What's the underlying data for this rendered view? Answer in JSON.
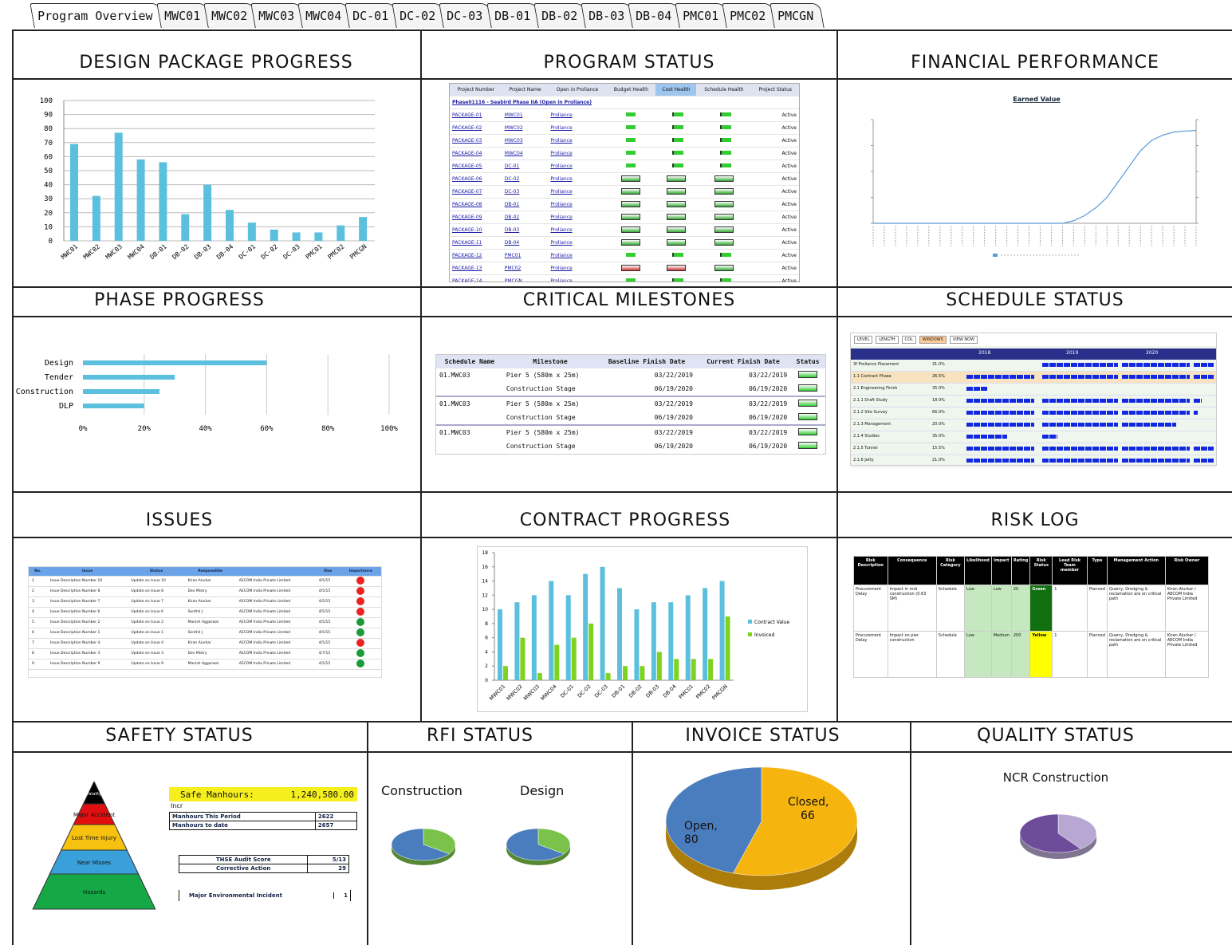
{
  "tabs": [
    "Program Overview",
    "MWC01",
    "MWC02",
    "MWC03",
    "MWC04",
    "DC-01",
    "DC-02",
    "DC-03",
    "DB-01",
    "DB-02",
    "DB-03",
    "DB-04",
    "PMC01",
    "PMC02",
    "PMCGN"
  ],
  "panels": {
    "design_package_progress": "DESIGN PACKAGE PROGRESS",
    "program_status": "PROGRAM STATUS",
    "financial_performance": "FINANCIAL PERFORMANCE",
    "phase_progress": "PHASE PROGRESS",
    "critical_milestones": "CRITICAL MILESTONES",
    "schedule_status": "SCHEDULE STATUS",
    "issues": "ISSUES",
    "contract_progress": "CONTRACT PROGRESS",
    "risk_log": "RISK LOG",
    "safety_status": "SAFETY STATUS",
    "rfi_status": "RFI STATUS",
    "invoice_status": "INVOICE STATUS",
    "quality_status": "QUALITY STATUS"
  },
  "chart_data": [
    {
      "type": "bar",
      "name": "design-package-progress",
      "categories": [
        "MWC01",
        "MWC02",
        "MWC03",
        "MWC04",
        "DB-01",
        "DB-02",
        "DB-03",
        "DB-04",
        "DC-01",
        "DC-02",
        "DC-03",
        "PMC01",
        "PMC02",
        "PMCGN"
      ],
      "values": [
        69,
        32,
        77,
        58,
        56,
        19,
        40,
        22,
        13,
        8,
        6,
        6,
        11,
        17
      ],
      "ylim": [
        0,
        100
      ],
      "yticks": [
        0,
        10,
        20,
        30,
        40,
        50,
        60,
        70,
        80,
        90,
        100
      ]
    },
    {
      "type": "bar",
      "orientation": "horizontal",
      "name": "phase-progress",
      "categories": [
        "Design",
        "Tender",
        "Construction",
        "DLP"
      ],
      "values": [
        60,
        30,
        25,
        20
      ],
      "xticks": [
        "0%",
        "20%",
        "40%",
        "60%",
        "80%",
        "100%"
      ]
    },
    {
      "type": "bar",
      "name": "contract-progress",
      "categories": [
        "MWC01",
        "MWC02",
        "MWC03",
        "MWC04",
        "DC-01",
        "DC-02",
        "DC-03",
        "DB-01",
        "DB-02",
        "DB-03",
        "DB-04",
        "PMC01",
        "PMC02",
        "PMCGN"
      ],
      "series": [
        {
          "name": "Contract Value",
          "values": [
            10,
            11,
            12,
            14,
            12,
            15,
            16,
            13,
            10,
            11,
            11,
            12,
            13,
            14
          ]
        },
        {
          "name": "Invoiced",
          "values": [
            2,
            6,
            1,
            5,
            6,
            8,
            1,
            2,
            2,
            4,
            3,
            3,
            3,
            9
          ]
        }
      ],
      "ylim": [
        0,
        18
      ],
      "yticks": [
        0,
        2,
        4,
        6,
        8,
        10,
        12,
        14,
        16,
        18
      ],
      "legend": "right"
    },
    {
      "type": "line",
      "name": "financial-performance",
      "title": "Earned Value",
      "values": [
        0,
        0,
        0,
        0,
        0,
        0,
        0,
        0,
        0,
        0,
        0,
        0,
        0,
        0,
        0,
        0,
        0,
        0,
        0.5,
        1.5,
        3,
        5,
        8,
        11,
        14,
        16,
        17,
        17.6,
        17.8,
        17.9
      ],
      "ylim": [
        0,
        20
      ],
      "legend": "bottom"
    },
    {
      "type": "pie",
      "name": "invoice-status",
      "labels": [
        "Open",
        "Closed"
      ],
      "values": [
        80,
        66
      ],
      "colors": [
        "#f6b40f",
        "#4a7dbd"
      ]
    },
    {
      "type": "pie",
      "name": "rfi-construction",
      "title": "Construction",
      "labels": [
        "Open",
        "Closed"
      ],
      "values": [
        35,
        65
      ],
      "colors": [
        "#7bc24a",
        "#4a7dbd"
      ]
    },
    {
      "type": "pie",
      "name": "rfi-design",
      "title": "Design",
      "labels": [
        "Open",
        "Closed"
      ],
      "values": [
        35,
        65
      ],
      "colors": [
        "#7bc24a",
        "#4a7dbd"
      ]
    },
    {
      "type": "pie",
      "name": "quality-ncr",
      "title": "NCR Construction",
      "labels": [
        "Open",
        "Closed"
      ],
      "values": [
        40,
        60
      ],
      "colors": [
        "#b7a7d2",
        "#6d4c9a"
      ]
    }
  ],
  "program_status": {
    "headers": [
      "Project Number",
      "Project Name",
      "Open in Proliance",
      "Budget Health",
      "Cost Health",
      "Schedule Health",
      "Project Status"
    ],
    "group": "Phase01116 - Seabird Phase IIA (Open in Proliance)",
    "rows": [
      [
        "PACKAGE-01",
        "MWC01",
        "Proliance",
        "Active"
      ],
      [
        "PACKAGE-02",
        "MWC02",
        "Proliance",
        "Active"
      ],
      [
        "PACKAGE-03",
        "MWC03",
        "Proliance",
        "Active"
      ],
      [
        "PACKAGE-04",
        "MWC04",
        "Proliance",
        "Active"
      ],
      [
        "PACKAGE-05",
        "DC-01",
        "Proliance",
        "Active"
      ],
      [
        "PACKAGE-06",
        "DC-02",
        "Proliance",
        "Active"
      ],
      [
        "PACKAGE-07",
        "DC-03",
        "Proliance",
        "Active"
      ],
      [
        "PACKAGE-08",
        "DB-01",
        "Proliance",
        "Active"
      ],
      [
        "PACKAGE-09",
        "DB-02",
        "Proliance",
        "Active"
      ],
      [
        "PACKAGE-10",
        "DB-03",
        "Proliance",
        "Active"
      ],
      [
        "PACKAGE-11",
        "DB-04",
        "Proliance",
        "Active"
      ],
      [
        "PACKAGE-12",
        "PMC01",
        "Proliance",
        "Active"
      ],
      [
        "PACKAGE-13",
        "PMC02",
        "Proliance",
        "Active"
      ],
      [
        "PACKAGE-14",
        "PMCGN",
        "Proliance",
        "Active"
      ]
    ]
  },
  "critical_milestones": {
    "headers": [
      "Schedule Name",
      "Milestone",
      "Baseline Finish Date",
      "Current Finish Date",
      "Status"
    ],
    "rows": [
      [
        "01.MWC03",
        "Pier 5 (580m x 25m)",
        "03/22/2019",
        "03/22/2019"
      ],
      [
        "",
        "Construction Stage",
        "06/19/2020",
        "06/19/2020"
      ],
      [
        "01.MWC03",
        "Pier 5 (580m x 25m)",
        "03/22/2019",
        "03/22/2019"
      ],
      [
        "",
        "Construction Stage",
        "06/19/2020",
        "06/19/2020"
      ],
      [
        "01.MWC03",
        "Pier 5 (580m x 25m)",
        "03/22/2019",
        "03/22/2019"
      ],
      [
        "",
        "Construction Stage",
        "06/19/2020",
        "06/19/2020"
      ]
    ]
  },
  "schedule_status": {
    "years": [
      "2018",
      "2019",
      "2020"
    ],
    "rows": [
      [
        "3f Proliance Placement",
        "31.0%"
      ],
      [
        "1.1 Contract Phase",
        "26.5%"
      ],
      [
        "2.1 Engineering Finish",
        "35.0%"
      ],
      [
        "2.1.1 Draft Study",
        "18.0%"
      ],
      [
        "2.1.2 Site Survey",
        "66.0%"
      ],
      [
        "2.1.3 Management",
        "20.0%"
      ],
      [
        "2.1.4 Studies",
        "35.0%"
      ],
      [
        "2.1.5 Tunnel",
        "15.5%"
      ],
      [
        "2.1.6 Jetty",
        "21.0%"
      ]
    ]
  },
  "issues": {
    "headers": [
      "No.",
      "Issue",
      "Status",
      "Responsible",
      "",
      "Due",
      "Importance"
    ],
    "rows": [
      [
        "1",
        "Issue Description Number 10",
        "Update on Issue 10",
        "Kiran Alurkar",
        "AECOM India Private Limited",
        "4/5/15",
        "red"
      ],
      [
        "2",
        "Issue Description Number 8",
        "Update on Issue 8",
        "Dev Mistry",
        "AECOM India Private Limited",
        "4/5/15",
        "red"
      ],
      [
        "3",
        "Issue Description Number 7",
        "Update on Issue 7",
        "Kiran Alurkar",
        "AECOM India Private Limited",
        "4/5/15",
        "red"
      ],
      [
        "4",
        "Issue Description Number 6",
        "Update on Issue 6",
        "Senthil J",
        "AECOM India Private Limited",
        "4/5/15",
        "red"
      ],
      [
        "5",
        "Issue Description Number 2",
        "Update on Issue 2",
        "Manish Aggarwal",
        "AECOM India Private Limited",
        "4/5/15",
        "green"
      ],
      [
        "6",
        "Issue Description Number 1",
        "Update on Issue 1",
        "Senthil J",
        "AECOM India Private Limited",
        "4/5/15",
        "green"
      ],
      [
        "7",
        "Issue Description Number 4",
        "Update on Issue 4",
        "Kiran Alurkar",
        "AECOM India Private Limited",
        "4/5/15",
        "red"
      ],
      [
        "8",
        "Issue Description Number 3",
        "Update on Issue 3",
        "Dev Mistry",
        "AECOM India Private Limited",
        "4/7/15",
        "green"
      ],
      [
        "9",
        "Issue Description Number 9",
        "Update on Issue 9",
        "Manish Aggarwal",
        "AECOM India Private Limited",
        "4/5/15",
        "green"
      ]
    ]
  },
  "risk_log": {
    "headers": [
      "Risk Description",
      "Consequence",
      "Risk Category",
      "Likelihood",
      "Impact",
      "Rating",
      "Risk Status",
      "Lead Risk Team member",
      "Type",
      "Management Action",
      "Risk Owner"
    ],
    "rows": [
      [
        "Procurement Delay",
        "Impact in mid construction (0.63 SM)",
        "Schedule",
        "Low",
        "Low",
        "20",
        "Green",
        "1",
        "Planned",
        "Quarry, Dredging & reclamation are on critical path",
        "Kiran Alurkar / AECOM India Private Limited"
      ],
      [
        "Procurement Delay",
        "Impact on pier construction",
        "Schedule",
        "Low",
        "Medium",
        "200",
        "Yellow",
        "1",
        "Planned",
        "Quarry, Dredging & reclamation are on critical path",
        "Kiran Alurkar / AECOM India Private Limited"
      ]
    ]
  },
  "safety": {
    "safe_manhours_label": "Safe Manhours:",
    "safe_manhours_value": "1,240,580.00",
    "row0": "Incr",
    "manhours_period_label": "Manhours This Period",
    "manhours_period_value": "2622",
    "manhours_date_label": "Manhours to date",
    "manhours_date_value": "2657",
    "audit_label": "THSE Audit Score",
    "audit_value": "5/13",
    "corrective_label": "Corrective Action",
    "corrective_value": "29",
    "env_label": "Major Environmental Incident",
    "env_value": "1",
    "pyramid": [
      "Fatality",
      "Major Accident",
      "Lost Time Injury",
      "Near Misses",
      "Hazards"
    ]
  },
  "rfi": {
    "construction": "Construction",
    "design": "Design"
  },
  "invoice": {
    "open_label": "Open,",
    "open_value": "80",
    "closed_label": "Closed,",
    "closed_value": "66"
  },
  "quality": {
    "title": "NCR Construction"
  },
  "colors": {
    "bar_blue": "#5bc0de",
    "bar_green": "#7ed321",
    "pie_open": "#f6b40f",
    "pie_closed": "#4a7dbd"
  }
}
